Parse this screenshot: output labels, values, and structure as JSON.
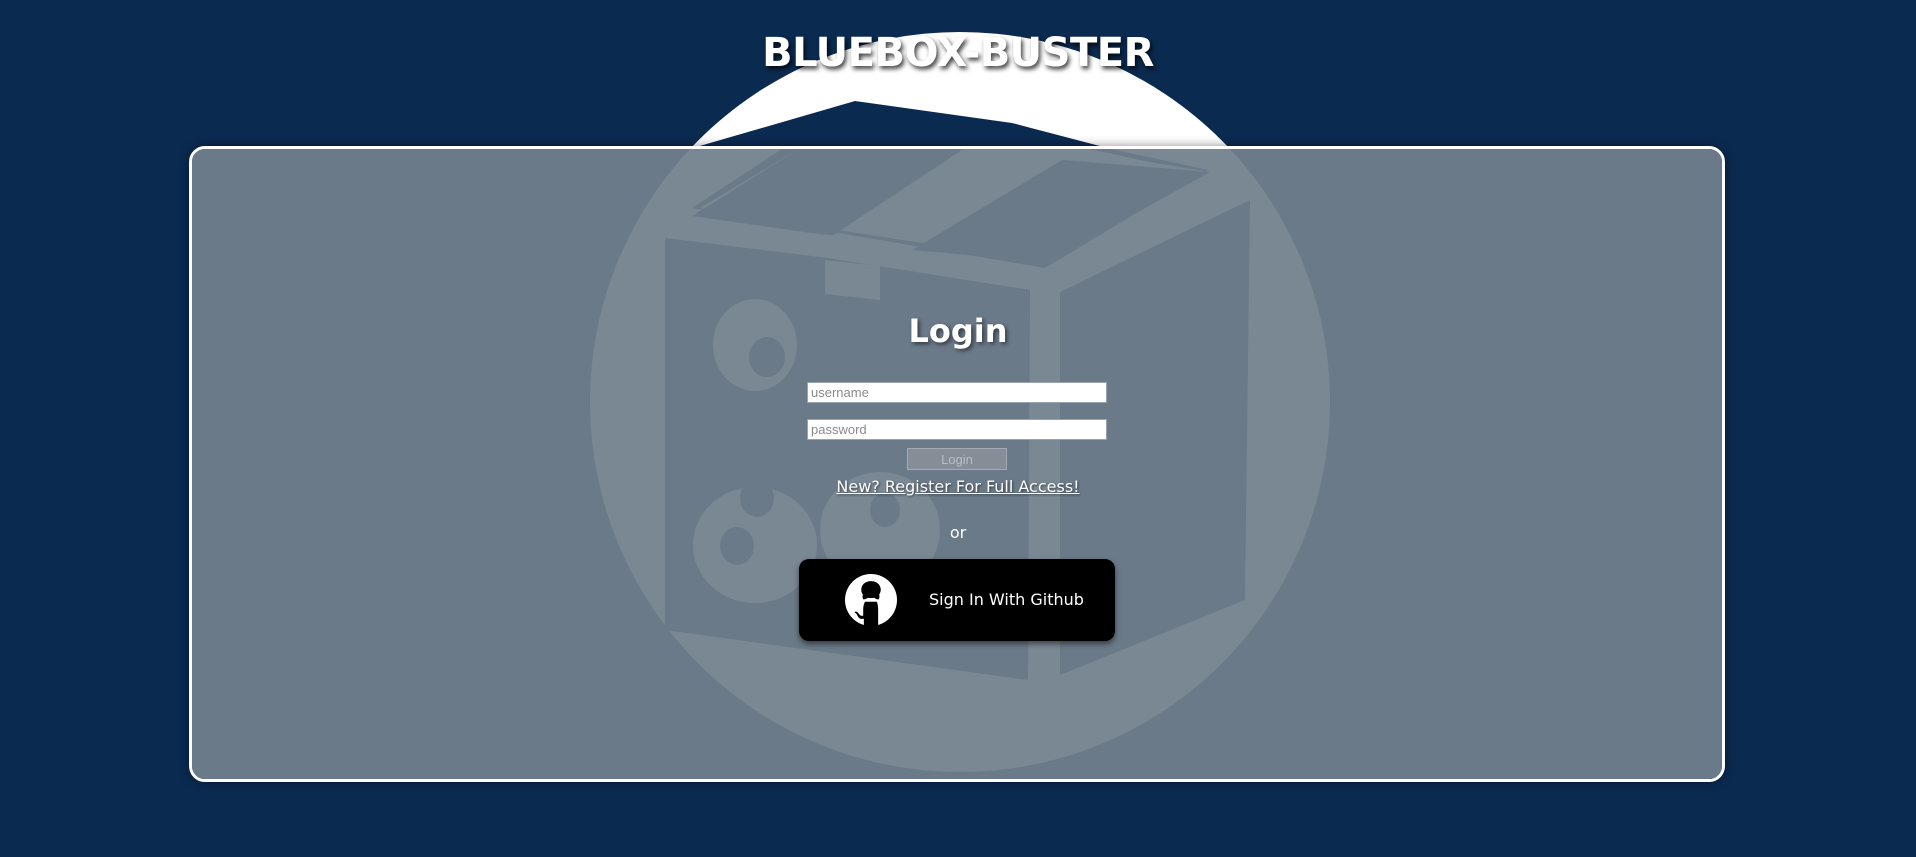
{
  "app": {
    "title": "BLUEBOX-BUSTER"
  },
  "login": {
    "heading": "Login",
    "username": {
      "value": "",
      "placeholder": "username"
    },
    "password": {
      "value": "",
      "placeholder": "password"
    },
    "submit_label": "Login",
    "register_link": "New? Register For Full Access!",
    "or_text": "or",
    "github_button": "Sign In With Github"
  },
  "colors": {
    "background": "#0b2a50",
    "panel": "#6b7a89",
    "logo_disc": "#7a8894",
    "button_black": "#000000"
  },
  "icons": {
    "logo": "box-icon",
    "github": "github-icon"
  }
}
